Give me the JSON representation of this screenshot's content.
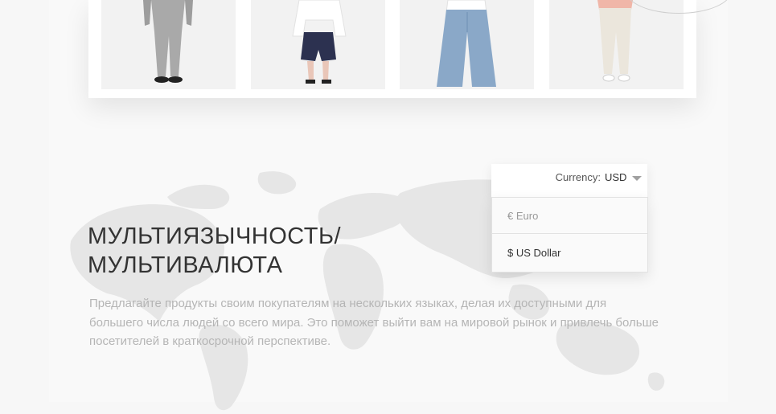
{
  "products": [
    {
      "alt": "grey suit"
    },
    {
      "alt": "white blouse and navy shorts"
    },
    {
      "alt": "wide-leg jeans"
    },
    {
      "alt": "white trousers and striped top"
    }
  ],
  "section": {
    "title_line1": "МУЛЬТИЯЗЫЧНОСТЬ/",
    "title_line2": "МУЛЬТИВАЛЮТА",
    "description": "Предлагайте продукты своим покупателям на нескольких языках, делая их доступными для большего числа людей со всего мира. Это поможет выйти вам на мировой рынок и привлечь больше посетителей в краткосрочной перспективе."
  },
  "currency": {
    "label": "Currency:",
    "value": "USD",
    "options": [
      {
        "label": "€ Euro"
      },
      {
        "label": "$ US Dollar"
      }
    ]
  },
  "colors": {
    "title": "#333333",
    "description": "#b5b5b5",
    "map": "#e4e4e4"
  }
}
